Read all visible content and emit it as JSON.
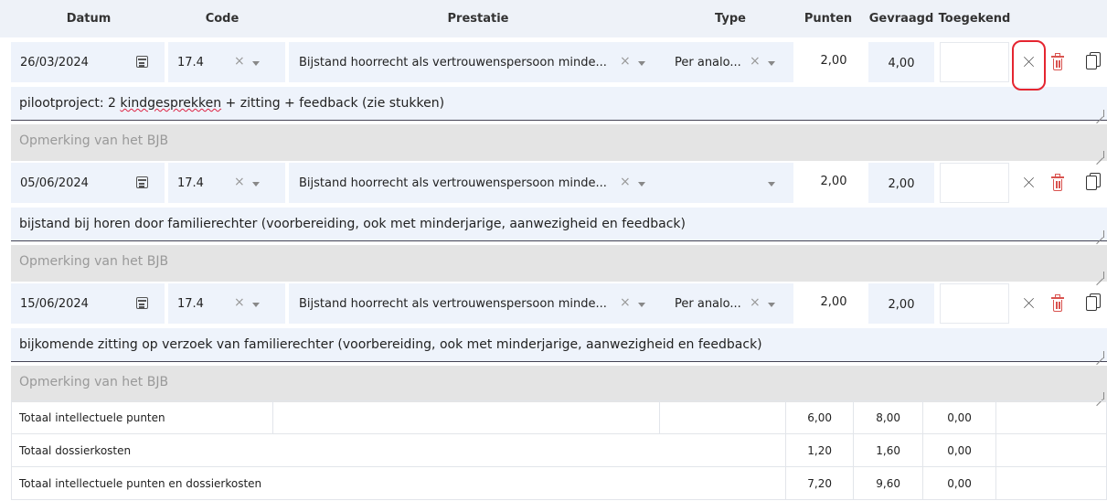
{
  "header": {
    "datum": "Datum",
    "code": "Code",
    "prestatie": "Prestatie",
    "type": "Type",
    "punten": "Punten",
    "gevraagd": "Gevraagd",
    "toegekend": "Toegekend"
  },
  "rows": [
    {
      "date": "26/03/2024",
      "code": "17.4",
      "prestatie": "Bijstand hoorrecht als vertrouwenspersoon minde...",
      "type": "Per analo...",
      "punten": "2,00",
      "gevraagd": "4,00",
      "toegekend": "",
      "description_pre": "pilootproject: 2 ",
      "description_mark": "kindgesprekken",
      "description_post": " + zitting + feedback (zie stukken)",
      "remark_placeholder": "Opmerking van het BJB"
    },
    {
      "date": "05/06/2024",
      "code": "17.4",
      "prestatie": "Bijstand hoorrecht als vertrouwenspersoon minde...",
      "type": "",
      "punten": "2,00",
      "gevraagd": "2,00",
      "toegekend": "",
      "description_pre": "bijstand bij horen door familierechter (voorbereiding, ook met minderjarige, aanwezigheid en feedback)",
      "description_mark": "",
      "description_post": "",
      "remark_placeholder": "Opmerking van het BJB"
    },
    {
      "date": "15/06/2024",
      "code": "17.4",
      "prestatie": "Bijstand hoorrecht als vertrouwenspersoon minde...",
      "type": "Per analo...",
      "punten": "2,00",
      "gevraagd": "2,00",
      "toegekend": "",
      "description_pre": "bijkomende zitting op verzoek van familierechter (voorbereiding, ook met minderjarige, aanwezigheid en feedback)",
      "description_mark": "",
      "description_post": "",
      "remark_placeholder": "Opmerking van het BJB"
    }
  ],
  "totals": [
    {
      "label": "Totaal intellectuele punten",
      "punten": "6,00",
      "gevraagd": "8,00",
      "toegekend": "0,00"
    },
    {
      "label": "Totaal dossierkosten",
      "punten": "1,20",
      "gevraagd": "1,60",
      "toegekend": "0,00"
    },
    {
      "label": "Totaal intellectuele punten en dossierkosten",
      "punten": "7,20",
      "gevraagd": "9,60",
      "toegekend": "0,00"
    }
  ],
  "icons": {
    "clear": "×",
    "calendar": "calendar-icon",
    "expand": "expand-collapse-icon",
    "delete": "trash-icon",
    "copy": "copy-icon"
  },
  "colors": {
    "header_bg": "#eef2f8",
    "field_bg": "#eef3fb",
    "remark_bg": "#e4e4e4",
    "delete_red": "#d9534f",
    "highlight_red": "#e52530"
  }
}
